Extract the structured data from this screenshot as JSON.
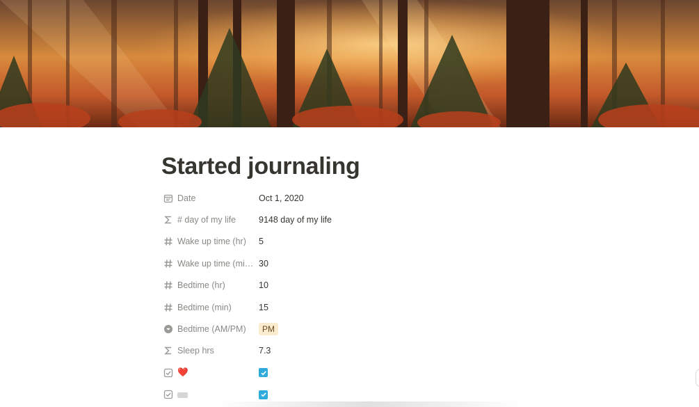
{
  "page": {
    "title": "Started journaling",
    "cover_description_icon": "forest-cover-image"
  },
  "properties": [
    {
      "icon": "calendar-icon",
      "name": "Date",
      "value": "Oct 1, 2020",
      "type": "date"
    },
    {
      "icon": "sigma-icon",
      "name": "# day of my life",
      "value": "9148 day of my life",
      "type": "formula"
    },
    {
      "icon": "hash-icon",
      "name": "Wake up time (hr)",
      "value": "5",
      "type": "number"
    },
    {
      "icon": "hash-icon",
      "name": "Wake up time (mi…",
      "value": "30",
      "type": "number"
    },
    {
      "icon": "hash-icon",
      "name": "Bedtime (hr)",
      "value": "10",
      "type": "number"
    },
    {
      "icon": "hash-icon",
      "name": "Bedtime (min)",
      "value": "15",
      "type": "number"
    },
    {
      "icon": "select-icon",
      "name": "Bedtime (AM/PM)",
      "value": "PM",
      "type": "select"
    },
    {
      "icon": "sigma-icon",
      "name": "Sleep hrs",
      "value": "7.3",
      "type": "formula"
    },
    {
      "icon": "checkbox-icon",
      "name": "❤️",
      "value": "",
      "type": "checkbox",
      "checked": true
    },
    {
      "icon": "checkbox-icon",
      "name": "",
      "value": "",
      "type": "checkbox",
      "checked": true
    }
  ],
  "colors": {
    "text": "#37352f",
    "muted": "#9b9a97",
    "checkbox": "#2eaadc",
    "select_tag_bg": "#fbecd0"
  }
}
